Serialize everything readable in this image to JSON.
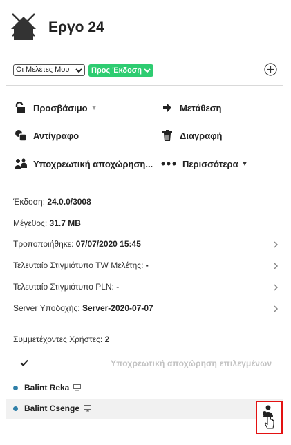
{
  "project": {
    "title": "Εργο 24"
  },
  "filters": {
    "my_studies": "Οι Μελέτες Μου",
    "status": "Προς Έκδοση"
  },
  "actions": {
    "access": "Προσβάσιμο",
    "move": "Μετάθεση",
    "copy": "Αντίγραφο",
    "delete": "Διαγραφή",
    "force_leave": "Υποχρεωτική αποχώρηση...",
    "more": "Περισσότερα"
  },
  "info": {
    "version_label": "Έκδοση:",
    "version_value": "24.0.0/3008",
    "size_label": "Μέγεθος:",
    "size_value": "31.7 MB",
    "modified_label": "Τροποποιήθηκε:",
    "modified_value": "07/07/2020 15:45",
    "tw_snapshot_label": "Τελευταίο Στιγμιότυπο TW Μελέτης:",
    "tw_snapshot_value": "-",
    "pln_snapshot_label": "Τελευταίο Στιγμιότυπο PLN:",
    "pln_snapshot_value": "-",
    "server_label": "Server Υποδοχής:",
    "server_value": "Server-2020-07-07"
  },
  "users": {
    "header_label": "Συμμετέχοντες Χρήστες:",
    "count": "2",
    "bulk_action": "Υποχρεωτική αποχώρηση επιλεγμένων",
    "list": [
      {
        "name": "Balint Reka"
      },
      {
        "name": "Balint Csenge"
      }
    ]
  },
  "colors": {
    "status_green": "#2ecc71",
    "online_dot": "#2f7fa8",
    "highlight_red": "#e31212"
  }
}
